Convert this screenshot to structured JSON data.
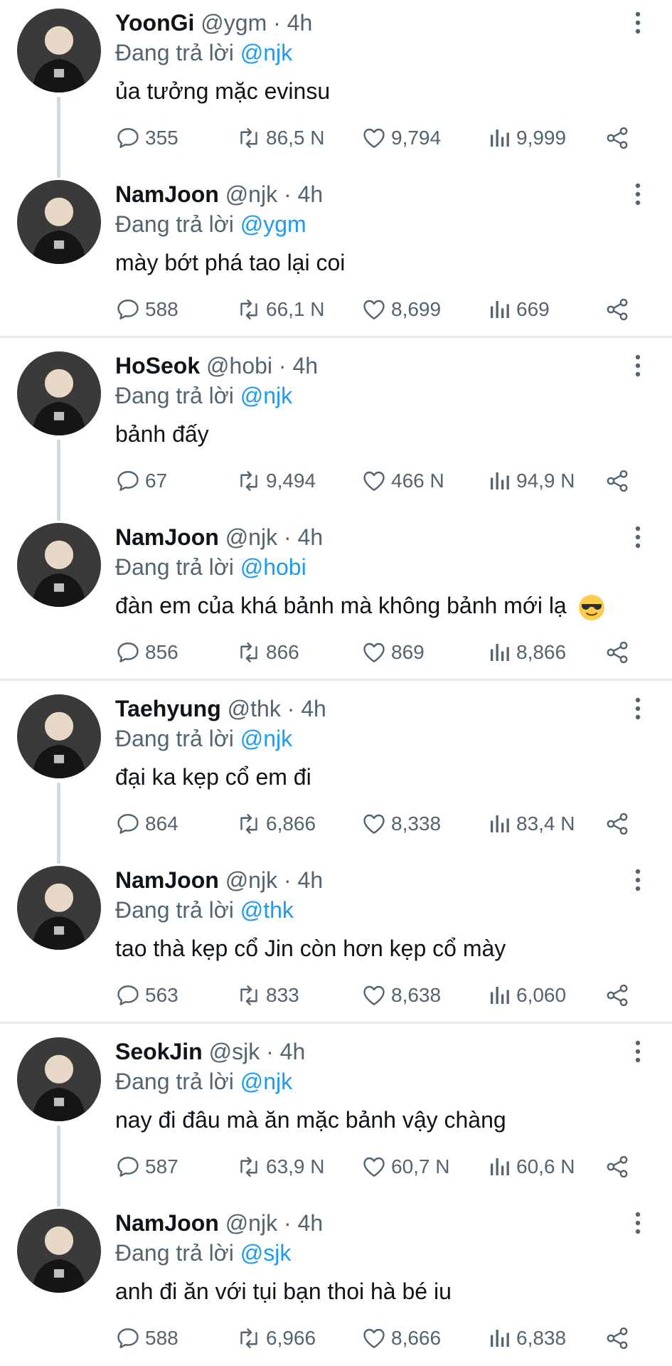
{
  "colors": {
    "name": "#0f1419",
    "secondary": "#536471",
    "mention": "#1d9bf0",
    "divider": "#e6ecf0",
    "connector": "#cfd9de"
  },
  "reply_prefix": "Đang trả lời",
  "threads": [
    {
      "tweets": [
        {
          "name": "YoonGi",
          "handle": "@ygm · 4h",
          "reply_to": "@njk",
          "text": "ủa tưởng mặc evinsu",
          "replies": "355",
          "retweets": "86,5 N",
          "likes": "9,794",
          "views": "9,999"
        },
        {
          "name": "NamJoon",
          "handle": "@njk · 4h",
          "reply_to": "@ygm",
          "text": "mày bớt phá tao lại coi",
          "replies": "588",
          "retweets": "66,1 N",
          "likes": "8,699",
          "views": "669"
        }
      ]
    },
    {
      "tweets": [
        {
          "name": "HoSeok",
          "handle": "@hobi · 4h",
          "reply_to": "@njk",
          "text": "bảnh đấy",
          "replies": "67",
          "retweets": "9,494",
          "likes": "466 N",
          "views": "94,9 N"
        },
        {
          "name": "NamJoon",
          "handle": "@njk · 4h",
          "reply_to": "@hobi",
          "text": "đàn em của khá bảnh mà không bảnh mới lạ",
          "emoji": "sunglasses-emoji",
          "replies": "856",
          "retweets": "866",
          "likes": "869",
          "views": "8,866"
        }
      ]
    },
    {
      "tweets": [
        {
          "name": "Taehyung",
          "handle": "@thk · 4h",
          "reply_to": "@njk",
          "text": "đại ka kẹp cổ em đi",
          "replies": "864",
          "retweets": "6,866",
          "likes": "8,338",
          "views": "83,4 N"
        },
        {
          "name": "NamJoon",
          "handle": "@njk · 4h",
          "reply_to": "@thk",
          "text": "tao thà kẹp cổ Jin còn hơn kẹp cổ mày",
          "replies": "563",
          "retweets": "833",
          "likes": "8,638",
          "views": "6,060"
        }
      ]
    },
    {
      "tweets": [
        {
          "name": "SeokJin",
          "handle": "@sjk · 4h",
          "reply_to": "@njk",
          "text": "nay đi đâu mà ăn mặc bảnh vậy chàng",
          "replies": "587",
          "retweets": "63,9 N",
          "likes": "60,7 N",
          "views": "60,6 N"
        },
        {
          "name": "NamJoon",
          "handle": "@njk · 4h",
          "reply_to": "@sjk",
          "text": "anh đi ăn với tụi bạn thoi hà bé iu",
          "replies": "588",
          "retweets": "6,966",
          "likes": "8,666",
          "views": "6,838"
        }
      ]
    }
  ]
}
